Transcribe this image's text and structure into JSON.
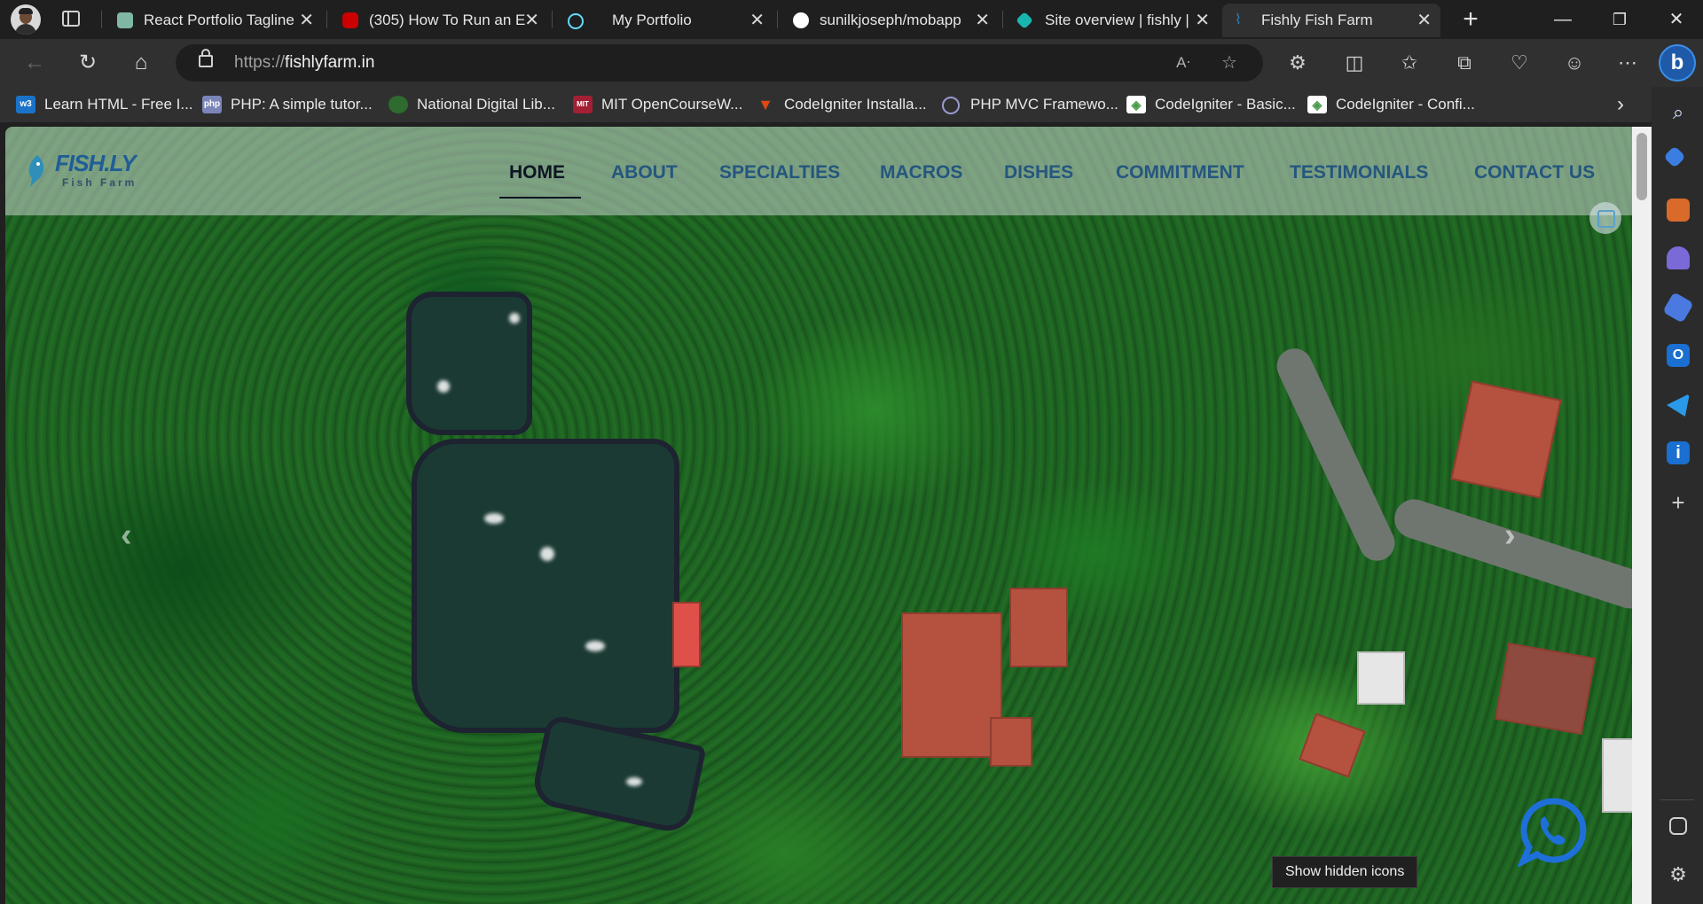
{
  "browser": {
    "tabs": [
      {
        "title": "React Portfolio Tagline",
        "icon": "chatgpt-icon",
        "color": "#7fb6a4"
      },
      {
        "title": "(305) How To Run an E",
        "icon": "youtube-icon",
        "color": "#cc0000"
      },
      {
        "title": "My Portfolio",
        "icon": "react-icon",
        "color": "#61dafb"
      },
      {
        "title": "sunilkjoseph/mobapp",
        "icon": "github-icon",
        "color": "#ffffff"
      },
      {
        "title": "Site overview | fishly |",
        "icon": "netlify-icon",
        "color": "#19b6b0"
      },
      {
        "title": "Fishly Fish Farm",
        "icon": "fishly-icon",
        "color": "#2a7fb8"
      }
    ],
    "active_tab": 5,
    "address": {
      "scheme": "https://",
      "host": "fishlyfarm.in"
    },
    "favorites": [
      {
        "label": "Learn HTML - Free I...",
        "icon": "w3-icon",
        "color": "#1a73c9"
      },
      {
        "label": "PHP: A simple tutor...",
        "icon": "php-icon",
        "color": "#7a86b8"
      },
      {
        "label": "National Digital Lib...",
        "icon": "ndl-icon",
        "color": "#2e6b2e"
      },
      {
        "label": "MIT OpenCourseW...",
        "icon": "mit-icon",
        "color": "#a31f34"
      },
      {
        "label": "CodeIgniter Installa...",
        "icon": "codeigniter-icon",
        "color": "#dd4814"
      },
      {
        "label": "PHP MVC Framewo...",
        "icon": "mvc-icon",
        "color": "#5a5a9a"
      },
      {
        "label": "CodeIgniter - Basic...",
        "icon": "tutorialspoint-icon",
        "color": "#4a9a4a"
      },
      {
        "label": "CodeIgniter - Confi...",
        "icon": "tutorialspoint-icon",
        "color": "#4a9a4a"
      }
    ]
  },
  "site": {
    "logo": {
      "brand": "FISH.LY",
      "sub": "Fish Farm"
    },
    "nav": [
      "HOME",
      "ABOUT",
      "SPECIALTIES",
      "MACROS",
      "DISHES",
      "COMMITMENT",
      "TESTIMONIALS",
      "CONTACT US"
    ],
    "active_nav": "HOME"
  },
  "tooltip": "Show hidden icons"
}
